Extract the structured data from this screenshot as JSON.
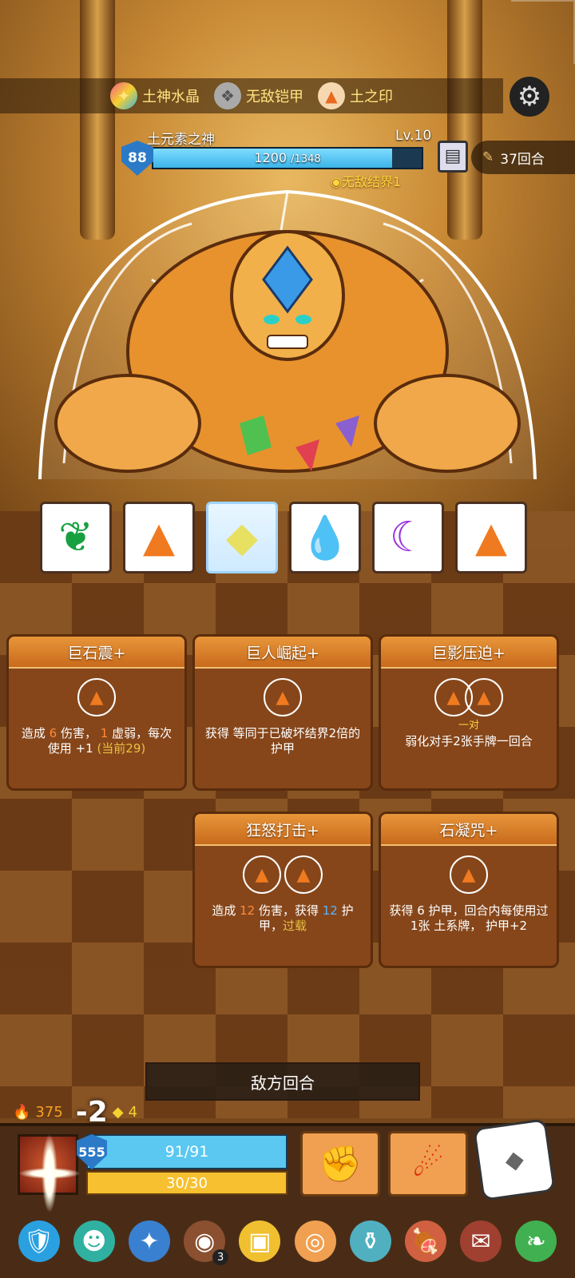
{
  "relics": [
    {
      "icon": "crystal-icon",
      "label": "土神水晶"
    },
    {
      "icon": "armor-icon",
      "label": "无敌铠甲"
    },
    {
      "icon": "earth-seal-icon",
      "label": "土之印"
    }
  ],
  "boss": {
    "name": "土元素之神",
    "level": "Lv.10",
    "shield": "88",
    "hp_text": "1200",
    "hp_max_text": "/1348",
    "hp_fraction": 0.89,
    "status": "无敌结界1"
  },
  "turns": "37回合",
  "elements": [
    {
      "icon": "leaf-icon",
      "glyph": "❦",
      "color": "#18a040"
    },
    {
      "icon": "earth-icon",
      "glyph": "▲",
      "color": "#f07a20"
    },
    {
      "icon": "diamond-icon",
      "glyph": "◆",
      "color": "#e8e060",
      "frozen": true
    },
    {
      "icon": "water-drop-icon",
      "glyph": "💧",
      "color": "#1a6ae0"
    },
    {
      "icon": "moon-icon",
      "glyph": "☾",
      "color": "#9a30e0"
    },
    {
      "icon": "earth-icon",
      "glyph": "▲",
      "color": "#f07a20"
    }
  ],
  "cards": [
    {
      "title": "巨石震+",
      "slots": 1,
      "sub": "",
      "desc": [
        "造成 ",
        "6",
        " 伤害， ",
        "1",
        " 虚弱，每次使用 ",
        "+1",
        " (当前29)"
      ]
    },
    {
      "title": "巨人崛起+",
      "slots": 1,
      "sub": "",
      "desc_text": "获得 等同于已破坏结界2倍的 护甲"
    },
    {
      "title": "巨影压迫+",
      "slots": 2,
      "sub": "一对",
      "desc_text": "弱化对手2张手牌一回合"
    },
    {
      "title": "狂怒打击+",
      "slots": 2,
      "sub": "",
      "desc": [
        "造成 ",
        "12",
        " 伤害，获得 ",
        "12",
        " 护甲，",
        "过载"
      ]
    },
    {
      "title": "石凝咒+",
      "slots": 1,
      "sub": "",
      "desc_text": "获得 6 护甲，回合内每使用过1张 土系牌， 护甲+2"
    }
  ],
  "enemy_turn": "敌方回合",
  "player": {
    "burn": "375",
    "damage_popup": "-2",
    "energy_gain": "4",
    "shield": "555",
    "hp": "91/91",
    "energy": "30/30"
  },
  "items": [
    {
      "name": "shield-icon",
      "glyph": "🛡"
    },
    {
      "name": "mask-icon",
      "glyph": "☻"
    },
    {
      "name": "compass-icon",
      "glyph": "✦"
    },
    {
      "name": "coin-icon",
      "glyph": "◉",
      "badge": "3"
    },
    {
      "name": "box-icon",
      "glyph": "▣"
    },
    {
      "name": "eye-icon",
      "glyph": "◎"
    },
    {
      "name": "vase-icon",
      "glyph": "⚱"
    },
    {
      "name": "meat-icon",
      "glyph": "🍖"
    },
    {
      "name": "book-icon",
      "glyph": "✉"
    },
    {
      "name": "herb-icon",
      "glyph": "❧"
    }
  ]
}
